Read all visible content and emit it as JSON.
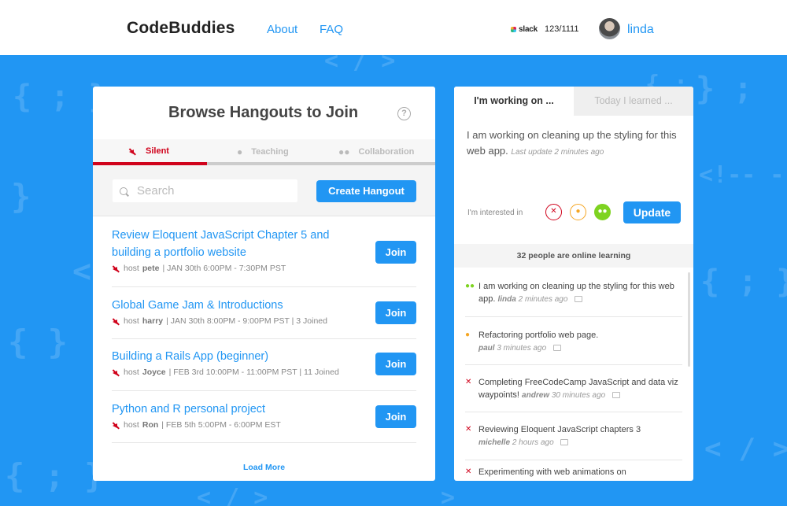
{
  "nav": {
    "brand": "CodeBuddies",
    "links": [
      "About",
      "FAQ"
    ],
    "slack_label": "slack",
    "slack_count": "123/1111",
    "username": "linda"
  },
  "background_glyphs": [
    "{ ; }",
    "< / >",
    "}",
    "{ }",
    "<",
    "{ ; }",
    "{ ; }",
    "<!-- --",
    "} ;",
    "< / >",
    "{ ;",
    "< / >",
    ">"
  ],
  "browse": {
    "title": "Browse Hangouts to Join",
    "help": "?",
    "tabs": [
      {
        "label": "Silent",
        "active": true
      },
      {
        "label": "Teaching",
        "active": false
      },
      {
        "label": "Collaboration",
        "active": false
      }
    ],
    "search_placeholder": "Search",
    "create_label": "Create Hangout",
    "join_label": "Join",
    "load_more": "Load More",
    "hangouts": [
      {
        "title": "Review Eloquent JavaScript Chapter 5 and building a portfolio website",
        "host_prefix": "host",
        "host": "pete",
        "details": "| JAN 30th 6:00PM - 7:30PM PST"
      },
      {
        "title": "Global Game Jam & Introductions",
        "host_prefix": "host",
        "host": "harry",
        "details": "| JAN 30th 8:00PM - 9:00PM PST | 3 Joined"
      },
      {
        "title": "Building a Rails App (beginner)",
        "host_prefix": "host",
        "host": "Joyce",
        "details": "| FEB 3rd 10:00PM - 11:00PM PST | 11 Joined"
      },
      {
        "title": "Python and R personal project",
        "host_prefix": "host",
        "host": "Ron",
        "details": "| FEB 5th 5:00PM - 6:00PM EST"
      }
    ]
  },
  "status": {
    "tab_active": "I'm working on ...",
    "tab_inactive": "Today I learned ...",
    "text": "I am working on cleaning up the styling for this web app.",
    "last_update": "Last update 2 minutes ago",
    "interested_label": "I'm interested in",
    "update_label": "Update",
    "online_header": "32 people are online learning",
    "feed": [
      {
        "icon": "people-icon",
        "text": "I am working on cleaning up the styling for this web app.",
        "user": "linda",
        "time": "2 minutes ago"
      },
      {
        "icon": "person-icon",
        "text": "Refactoring portfolio web page.",
        "user": "paul",
        "time": "3 minutes ago"
      },
      {
        "icon": "mute-icon",
        "text": "Completing FreeCodeCamp JavaScript and data viz waypoints!",
        "user": "andrew",
        "time": "30 minutes ago"
      },
      {
        "icon": "mute-icon",
        "text": "Reviewing Eloquent JavaScript chapters 3",
        "user": "michelle",
        "time": "2 hours ago"
      },
      {
        "icon": "mute-icon",
        "text": "Experimenting with web animations on",
        "user": "",
        "time": ""
      }
    ]
  },
  "colors": {
    "accent": "#2196f3",
    "silent": "#d0021b",
    "teaching": "#f5a623",
    "collaboration": "#7ed321"
  }
}
